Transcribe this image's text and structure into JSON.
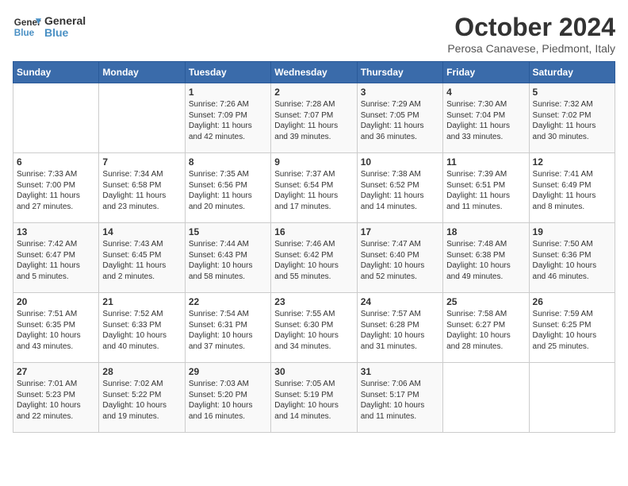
{
  "header": {
    "logo_line1": "General",
    "logo_line2": "Blue",
    "month_year": "October 2024",
    "location": "Perosa Canavese, Piedmont, Italy"
  },
  "days_of_week": [
    "Sunday",
    "Monday",
    "Tuesday",
    "Wednesday",
    "Thursday",
    "Friday",
    "Saturday"
  ],
  "weeks": [
    [
      {
        "day": "",
        "info": ""
      },
      {
        "day": "",
        "info": ""
      },
      {
        "day": "1",
        "info": "Sunrise: 7:26 AM\nSunset: 7:09 PM\nDaylight: 11 hours\nand 42 minutes."
      },
      {
        "day": "2",
        "info": "Sunrise: 7:28 AM\nSunset: 7:07 PM\nDaylight: 11 hours\nand 39 minutes."
      },
      {
        "day": "3",
        "info": "Sunrise: 7:29 AM\nSunset: 7:05 PM\nDaylight: 11 hours\nand 36 minutes."
      },
      {
        "day": "4",
        "info": "Sunrise: 7:30 AM\nSunset: 7:04 PM\nDaylight: 11 hours\nand 33 minutes."
      },
      {
        "day": "5",
        "info": "Sunrise: 7:32 AM\nSunset: 7:02 PM\nDaylight: 11 hours\nand 30 minutes."
      }
    ],
    [
      {
        "day": "6",
        "info": "Sunrise: 7:33 AM\nSunset: 7:00 PM\nDaylight: 11 hours\nand 27 minutes."
      },
      {
        "day": "7",
        "info": "Sunrise: 7:34 AM\nSunset: 6:58 PM\nDaylight: 11 hours\nand 23 minutes."
      },
      {
        "day": "8",
        "info": "Sunrise: 7:35 AM\nSunset: 6:56 PM\nDaylight: 11 hours\nand 20 minutes."
      },
      {
        "day": "9",
        "info": "Sunrise: 7:37 AM\nSunset: 6:54 PM\nDaylight: 11 hours\nand 17 minutes."
      },
      {
        "day": "10",
        "info": "Sunrise: 7:38 AM\nSunset: 6:52 PM\nDaylight: 11 hours\nand 14 minutes."
      },
      {
        "day": "11",
        "info": "Sunrise: 7:39 AM\nSunset: 6:51 PM\nDaylight: 11 hours\nand 11 minutes."
      },
      {
        "day": "12",
        "info": "Sunrise: 7:41 AM\nSunset: 6:49 PM\nDaylight: 11 hours\nand 8 minutes."
      }
    ],
    [
      {
        "day": "13",
        "info": "Sunrise: 7:42 AM\nSunset: 6:47 PM\nDaylight: 11 hours\nand 5 minutes."
      },
      {
        "day": "14",
        "info": "Sunrise: 7:43 AM\nSunset: 6:45 PM\nDaylight: 11 hours\nand 2 minutes."
      },
      {
        "day": "15",
        "info": "Sunrise: 7:44 AM\nSunset: 6:43 PM\nDaylight: 10 hours\nand 58 minutes."
      },
      {
        "day": "16",
        "info": "Sunrise: 7:46 AM\nSunset: 6:42 PM\nDaylight: 10 hours\nand 55 minutes."
      },
      {
        "day": "17",
        "info": "Sunrise: 7:47 AM\nSunset: 6:40 PM\nDaylight: 10 hours\nand 52 minutes."
      },
      {
        "day": "18",
        "info": "Sunrise: 7:48 AM\nSunset: 6:38 PM\nDaylight: 10 hours\nand 49 minutes."
      },
      {
        "day": "19",
        "info": "Sunrise: 7:50 AM\nSunset: 6:36 PM\nDaylight: 10 hours\nand 46 minutes."
      }
    ],
    [
      {
        "day": "20",
        "info": "Sunrise: 7:51 AM\nSunset: 6:35 PM\nDaylight: 10 hours\nand 43 minutes."
      },
      {
        "day": "21",
        "info": "Sunrise: 7:52 AM\nSunset: 6:33 PM\nDaylight: 10 hours\nand 40 minutes."
      },
      {
        "day": "22",
        "info": "Sunrise: 7:54 AM\nSunset: 6:31 PM\nDaylight: 10 hours\nand 37 minutes."
      },
      {
        "day": "23",
        "info": "Sunrise: 7:55 AM\nSunset: 6:30 PM\nDaylight: 10 hours\nand 34 minutes."
      },
      {
        "day": "24",
        "info": "Sunrise: 7:57 AM\nSunset: 6:28 PM\nDaylight: 10 hours\nand 31 minutes."
      },
      {
        "day": "25",
        "info": "Sunrise: 7:58 AM\nSunset: 6:27 PM\nDaylight: 10 hours\nand 28 minutes."
      },
      {
        "day": "26",
        "info": "Sunrise: 7:59 AM\nSunset: 6:25 PM\nDaylight: 10 hours\nand 25 minutes."
      }
    ],
    [
      {
        "day": "27",
        "info": "Sunrise: 7:01 AM\nSunset: 5:23 PM\nDaylight: 10 hours\nand 22 minutes."
      },
      {
        "day": "28",
        "info": "Sunrise: 7:02 AM\nSunset: 5:22 PM\nDaylight: 10 hours\nand 19 minutes."
      },
      {
        "day": "29",
        "info": "Sunrise: 7:03 AM\nSunset: 5:20 PM\nDaylight: 10 hours\nand 16 minutes."
      },
      {
        "day": "30",
        "info": "Sunrise: 7:05 AM\nSunset: 5:19 PM\nDaylight: 10 hours\nand 14 minutes."
      },
      {
        "day": "31",
        "info": "Sunrise: 7:06 AM\nSunset: 5:17 PM\nDaylight: 10 hours\nand 11 minutes."
      },
      {
        "day": "",
        "info": ""
      },
      {
        "day": "",
        "info": ""
      }
    ]
  ]
}
